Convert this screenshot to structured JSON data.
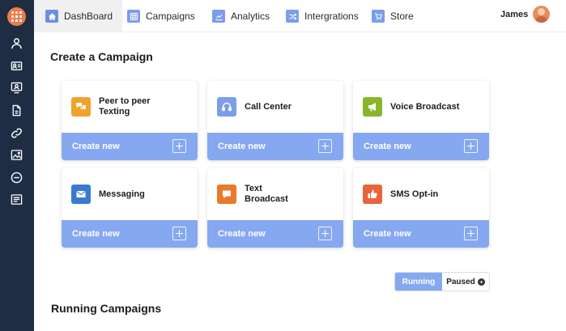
{
  "nav": {
    "items": [
      {
        "label": "DashBoard",
        "icon": "home-icon"
      },
      {
        "label": "Campaigns",
        "icon": "grid-icon"
      },
      {
        "label": "Analytics",
        "icon": "chart-icon"
      },
      {
        "label": "Intergrations",
        "icon": "shuffle-icon"
      },
      {
        "label": "Store",
        "icon": "cart-icon"
      }
    ],
    "user_name": "James"
  },
  "sidebar": {
    "icons": [
      "user-icon",
      "contact-card-icon",
      "presentation-icon",
      "document-icon",
      "link-icon",
      "image-icon",
      "minus-circle-icon",
      "form-icon"
    ]
  },
  "main": {
    "title": "Create a Campaign",
    "create_label": "Create new",
    "cards": [
      {
        "label": "Peer to peer\nTexting",
        "icon": "chat-bubbles-icon",
        "color": "#f0a32a"
      },
      {
        "label": "Call Center",
        "icon": "headset-icon",
        "color": "#7b9dea"
      },
      {
        "label": "Voice Broadcast",
        "icon": "megaphone-icon",
        "color": "#8ab52a"
      },
      {
        "label": "Messaging",
        "icon": "envelope-icon",
        "color": "#3a7bd0"
      },
      {
        "label": "Text\nBroadcast",
        "icon": "speech-bubble-icon",
        "color": "#e87a2e"
      },
      {
        "label": "SMS Opt-in",
        "icon": "thumbs-up-icon",
        "color": "#e8643a"
      }
    ],
    "toggle": {
      "running": "Running",
      "paused": "Paused"
    },
    "running_title": "Running Campaigns"
  },
  "colors": {
    "sidebar": "#1f2d44",
    "accent": "#86a8f0",
    "logo": "#ef7a4a"
  }
}
